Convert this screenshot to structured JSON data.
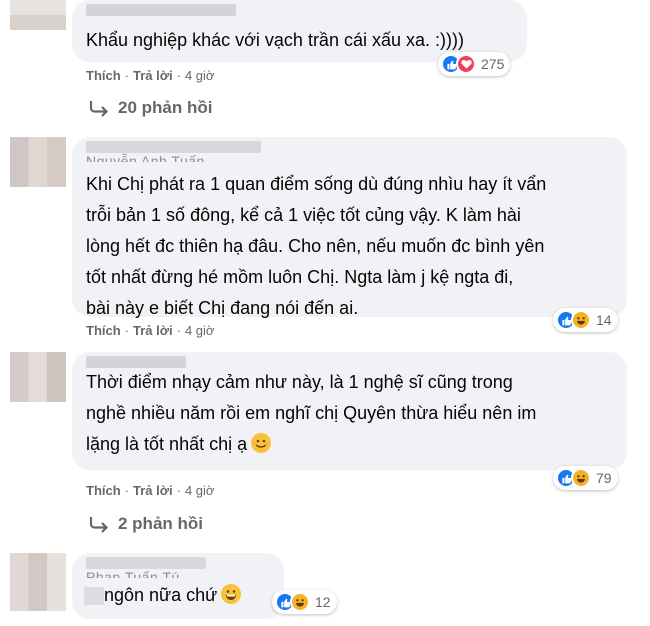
{
  "comments": [
    {
      "text": "Khẩu nghiệp khác với vạch trần cái xấu xa. :))))",
      "actions": {
        "like": "Thích",
        "reply": "Trả lời",
        "time": "4 giờ"
      },
      "reaction_count": "275",
      "replies_label": "20 phản hồi"
    },
    {
      "author_partial": "Nguyễn Anh Tuấn",
      "lines": [
        "Khi Chị phát ra 1 quan điểm sống dù đúng nhìu hay ít vẩn",
        "trỗi bản 1 số đông, kể cả 1 việc tốt củng vậy. K làm hài",
        "lòng hết đc thiên hạ đâu. Cho nên, nếu muốn đc bình yên",
        "tốt nhất đừng hé mồm luôn Chị. Ngta làm j kệ ngta đi,",
        "bài này e biết Chị đang nói đến ai."
      ],
      "actions": {
        "like": "Thích",
        "reply": "Trả lời",
        "time": "4 giờ"
      },
      "reaction_count": "14"
    },
    {
      "lines": [
        "Thời điểm nhạy cảm như này, là 1 nghệ sĩ cũng trong",
        "nghề nhiều năm rồi em nghĩ chị Quyên thừa hiểu nên im",
        "lặng là tốt nhất chị ạ"
      ],
      "actions": {
        "like": "Thích",
        "reply": "Trả lời",
        "time": "4 giờ"
      },
      "reaction_count": "79",
      "replies_label": "2 phản hồi"
    },
    {
      "author_partial": "Phan Tuấn Tú",
      "text": "ngôn nữa chứ",
      "reaction_count": "12"
    }
  ],
  "icons": {
    "like": "like-icon",
    "love": "love-icon",
    "haha": "haha-icon",
    "reply_arrow": "reply-arrow-icon",
    "emoji": "smile-emoji-icon"
  },
  "colors": {
    "like": "#1877f2",
    "love": "#f33e58",
    "haha": "#f7b125",
    "bubble": "#f0f2f5"
  }
}
